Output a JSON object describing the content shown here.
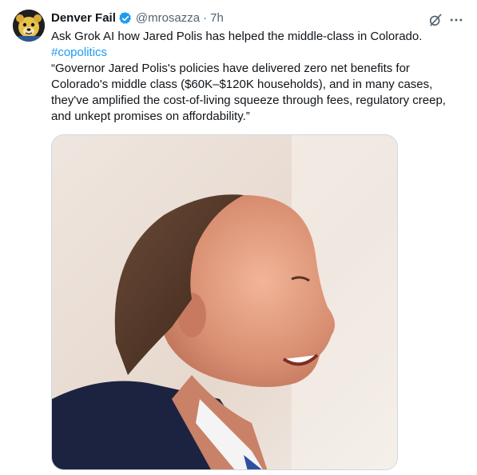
{
  "tweet": {
    "author": {
      "display_name": "Denver Fail",
      "handle": "@mrosazza",
      "verified": true,
      "avatar_icon": "mascot-avatar"
    },
    "separator": "·",
    "time": "7h",
    "text_lines": [
      "Ask Grok AI how Jared Polis has helped the middle-class in Colorado.",
      "#copolitics",
      "“Governor Jared Polis's policies have delivered zero net benefits for",
      "Colorado's middle class ($60K–$120K households), and in many cases,",
      "they've amplified the cost-of-living squeeze through fees, regulatory creep,",
      "and unkept promises on affordability.”"
    ],
    "hashtag_color": "#1d9bf0",
    "media_icon": "portrait-photo",
    "actions": [
      "grok-icon",
      "more-icon"
    ]
  },
  "colors": {
    "text": "#0f1419",
    "secondary": "#536471",
    "accent": "#1d9bf0",
    "verified": "#1d9bf0"
  }
}
